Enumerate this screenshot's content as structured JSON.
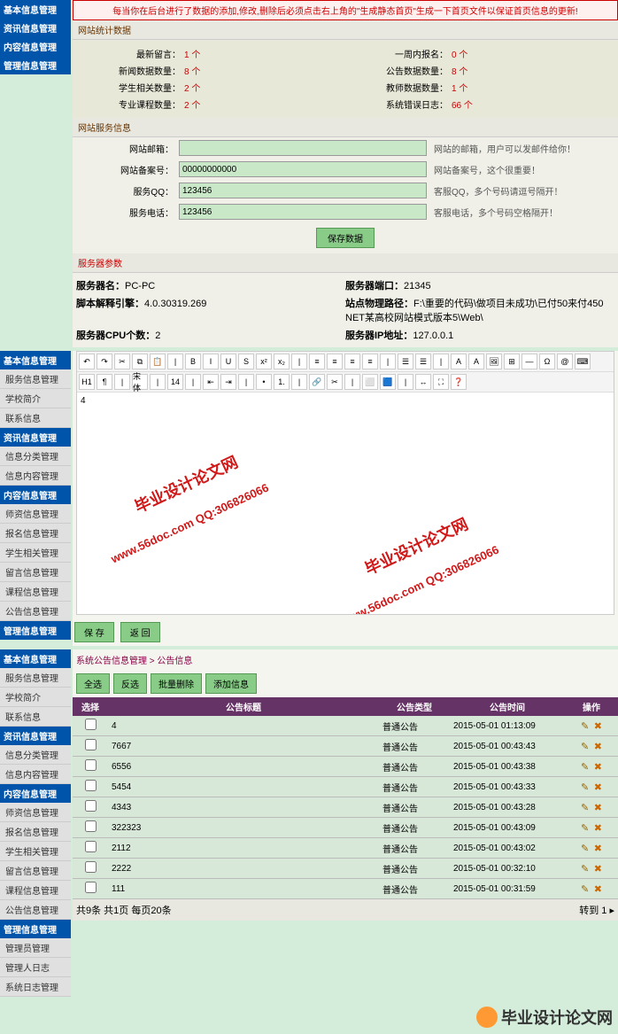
{
  "alert": "每当你在后台进行了数据的添加,修改,删除后必须点击右上角的\"生成静态首页\"生成一下首页文件以保证首页信息的更新!",
  "nav1": {
    "h1": "基本信息管理",
    "h2": "资讯信息管理",
    "h3": "内容信息管理",
    "h4": "管理信息管理"
  },
  "sec1": "网站统计数据",
  "stats": [
    {
      "l1": "最新留言：",
      "v1": "1 个",
      "l2": "一周内报名：",
      "v2": "0 个"
    },
    {
      "l1": "新闻数据数量：",
      "v1": "8 个",
      "l2": "公告数据数量：",
      "v2": "8 个"
    },
    {
      "l1": "学生相关数量：",
      "v1": "2 个",
      "l2": "教师数据数量：",
      "v2": "1 个"
    },
    {
      "l1": "专业课程数量：",
      "v1": "2 个",
      "l2": "系统错误日志：",
      "v2": "66 个"
    }
  ],
  "sec2": "网站服务信息",
  "form": [
    {
      "lbl": "网站邮箱：",
      "val": "",
      "hint": "网站的邮箱，用户可以发邮件给你！"
    },
    {
      "lbl": "网站备案号：",
      "val": "00000000000",
      "hint": "网站备案号，这个很重要！"
    },
    {
      "lbl": "服务QQ：",
      "val": "123456",
      "hint": "客服QQ，多个号码请逗号隔开！"
    },
    {
      "lbl": "服务电话：",
      "val": "123456",
      "hint": "客服电话，多个号码空格隔开！"
    }
  ],
  "btn_save": "保存数据",
  "sec3": "服务器参数",
  "params": [
    {
      "l1": "服务器名：",
      "v1": "PC-PC",
      "l2": "服务器端口：",
      "v2": "21345"
    },
    {
      "l1": "脚本解释引擎：",
      "v1": "4.0.30319.269",
      "l2": "站点物理路径：",
      "v2": "F:\\重要的代码\\做项目未成功\\已付50来付450 NET某高校网站模式版本5\\Web\\"
    },
    {
      "l1": "服务器CPU个数：",
      "v1": "2",
      "l2": "服务器IP地址：",
      "v2": "127.0.0.1"
    }
  ],
  "nav2": {
    "h1": "基本信息管理",
    "i1": [
      "服务信息管理",
      "学校简介",
      "联系信息"
    ],
    "h2": "资讯信息管理",
    "i2": [
      "信息分类管理",
      "信息内容管理"
    ],
    "h3": "内容信息管理",
    "i3": [
      "师资信息管理",
      "报名信息管理",
      "学生相关管理",
      "留言信息管理",
      "课程信息管理",
      "公告信息管理"
    ],
    "h4": "管理信息管理"
  },
  "ed_num": "4",
  "wm1": "毕业设计论文网",
  "wm2": "www.56doc.com  QQ:306826066",
  "btn_sv": "保 存",
  "btn_bk": "返 回",
  "nav3": {
    "h1": "基本信息管理",
    "i1": [
      "服务信息管理",
      "学校简介",
      "联系信息"
    ],
    "h2": "资讯信息管理",
    "i2": [
      "信息分类管理",
      "信息内容管理"
    ],
    "h3": "内容信息管理",
    "i3": [
      "师资信息管理",
      "报名信息管理",
      "学生相关管理",
      "留言信息管理",
      "课程信息管理",
      "公告信息管理"
    ],
    "h4": "管理信息管理",
    "i4": [
      "管理员管理",
      "管理人日志",
      "系统日志管理"
    ]
  },
  "crumb": "系统公告信息管理 > 公告信息",
  "actions": {
    "all": "全选",
    "inv": "反选",
    "del": "批量删除",
    "add": "添加信息"
  },
  "th": {
    "sel": "选择",
    "title": "公告标题",
    "type": "公告类型",
    "time": "公告时间",
    "op": "操作"
  },
  "rows": [
    {
      "title": "4",
      "type": "普通公告",
      "time": "2015-05-01 01:13:09"
    },
    {
      "title": "7667",
      "type": "普通公告",
      "time": "2015-05-01 00:43:43"
    },
    {
      "title": "6556",
      "type": "普通公告",
      "time": "2015-05-01 00:43:38"
    },
    {
      "title": "5454",
      "type": "普通公告",
      "time": "2015-05-01 00:43:33"
    },
    {
      "title": "4343",
      "type": "普通公告",
      "time": "2015-05-01 00:43:28"
    },
    {
      "title": "322323",
      "type": "普通公告",
      "time": "2015-05-01 00:43:09"
    },
    {
      "title": "2112",
      "type": "普通公告",
      "time": "2015-05-01 00:43:02"
    },
    {
      "title": "2222",
      "type": "普通公告",
      "time": "2015-05-01 00:32:10"
    },
    {
      "title": "111",
      "type": "普通公告",
      "time": "2015-05-01 00:31:59"
    }
  ],
  "pager_l": "共9条 共1页 每页20条",
  "pager_r": "转到 1 ▸",
  "logo": "毕业设计论文网"
}
